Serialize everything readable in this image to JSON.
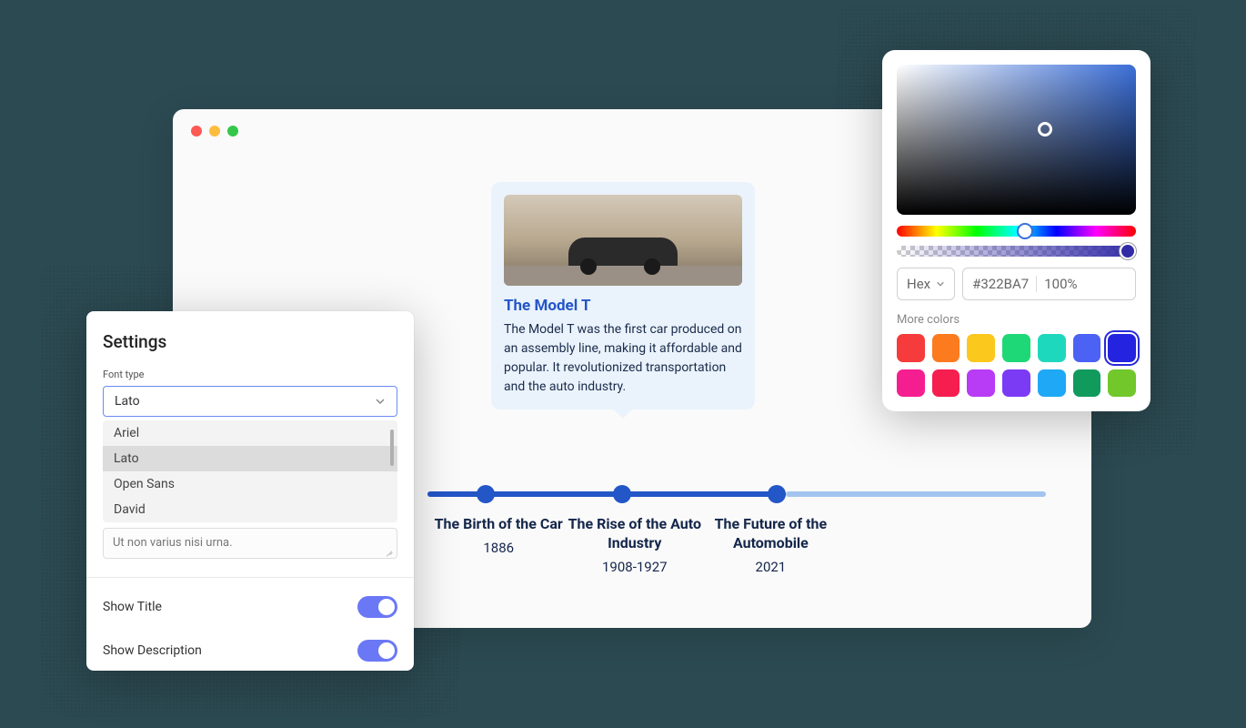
{
  "browser": {
    "controls": [
      "close",
      "minimize",
      "zoom"
    ]
  },
  "card": {
    "title": "The Model T",
    "text": "The Model T was the first car produced on an assembly line, making it affordable and popular. It revolutionized transportation and the auto industry."
  },
  "timeline": {
    "items": [
      {
        "title": "The Birth of the Car",
        "year": "1886"
      },
      {
        "title": "The Rise of the Auto Industry",
        "year": "1908-1927"
      },
      {
        "title": "The Future of the Automobile",
        "year": "2021"
      }
    ]
  },
  "settings": {
    "title": "Settings",
    "font_label": "Font type",
    "font_selected": "Lato",
    "font_options": [
      "Ariel",
      "Lato",
      "Open Sans",
      "David"
    ],
    "textarea_text": "Ut non varius nisi urna.",
    "show_title_label": "Show Title",
    "show_description_label": "Show Description",
    "show_title_on": true,
    "show_description_on": true
  },
  "color_picker": {
    "format": "Hex",
    "hex": "#322BA7",
    "alpha": "100%",
    "more_colors_label": "More colors",
    "swatches": [
      {
        "c": "#f53b3b"
      },
      {
        "c": "#fb7b1e"
      },
      {
        "c": "#fbc81e"
      },
      {
        "c": "#1ed877"
      },
      {
        "c": "#1ed8bd"
      },
      {
        "c": "#4b62f5"
      },
      {
        "c": "#2424e0",
        "sel": true
      },
      {
        "c": "#f51e90"
      },
      {
        "c": "#f51e4f"
      },
      {
        "c": "#b83bf5"
      },
      {
        "c": "#7b3bf5"
      },
      {
        "c": "#1ea8f5"
      },
      {
        "c": "#109a5c"
      },
      {
        "c": "#72c72a"
      }
    ]
  }
}
